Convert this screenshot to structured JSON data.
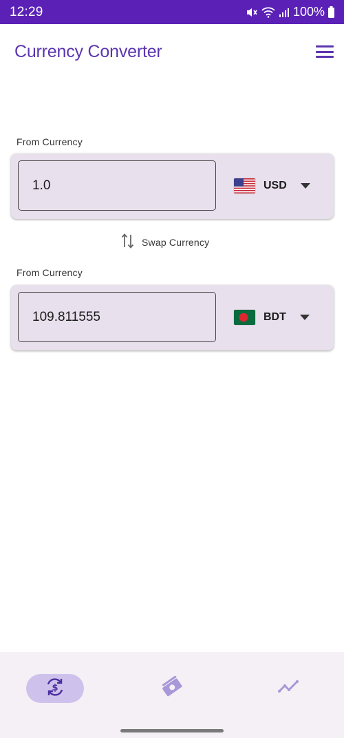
{
  "status_bar": {
    "time": "12:29",
    "battery": "100%"
  },
  "app_bar": {
    "title": "Currency Converter"
  },
  "converter": {
    "from": {
      "label": "From Currency",
      "amount": "1.0",
      "currency_code": "USD",
      "flag": "us-flag"
    },
    "swap_label": "Swap Currency",
    "to": {
      "label": "From Currency",
      "amount": "109.811555",
      "currency_code": "BDT",
      "flag": "bd-flag"
    }
  },
  "bottom_nav": {
    "items": [
      {
        "icon": "currency-exchange-icon",
        "active": true
      },
      {
        "icon": "payments-icon",
        "active": false
      },
      {
        "icon": "trending-icon",
        "active": false
      }
    ]
  },
  "colors": {
    "status_bar": "#5b21b6",
    "primary": "#5b35b0",
    "card_bg": "#e8e0ec",
    "nav_active": "#cec2ec"
  }
}
